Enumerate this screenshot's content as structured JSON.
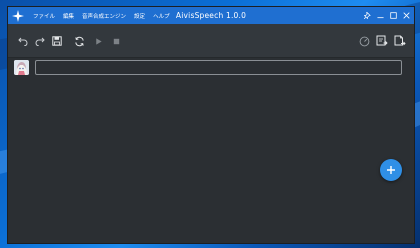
{
  "window": {
    "title": "AivisSpeech 1.0.0"
  },
  "menu": {
    "items": [
      {
        "label": "ファイル"
      },
      {
        "label": "編集"
      },
      {
        "label": "音声合成エンジン"
      },
      {
        "label": "設定"
      },
      {
        "label": "ヘルプ"
      }
    ]
  },
  "toolbar": {
    "left": [
      "undo-icon",
      "redo-icon",
      "save-icon",
      "sync-icon",
      "play-icon",
      "stop-icon"
    ],
    "right": [
      "speed-gauge-icon",
      "export-all-icon",
      "export-selected-icon"
    ]
  },
  "editor": {
    "input_value": "",
    "input_placeholder": ""
  },
  "colors": {
    "titlebar": "#1f6fd1",
    "toolbar": "#33383d",
    "content": "#2b2f33",
    "accent": "#2f8fe6"
  }
}
